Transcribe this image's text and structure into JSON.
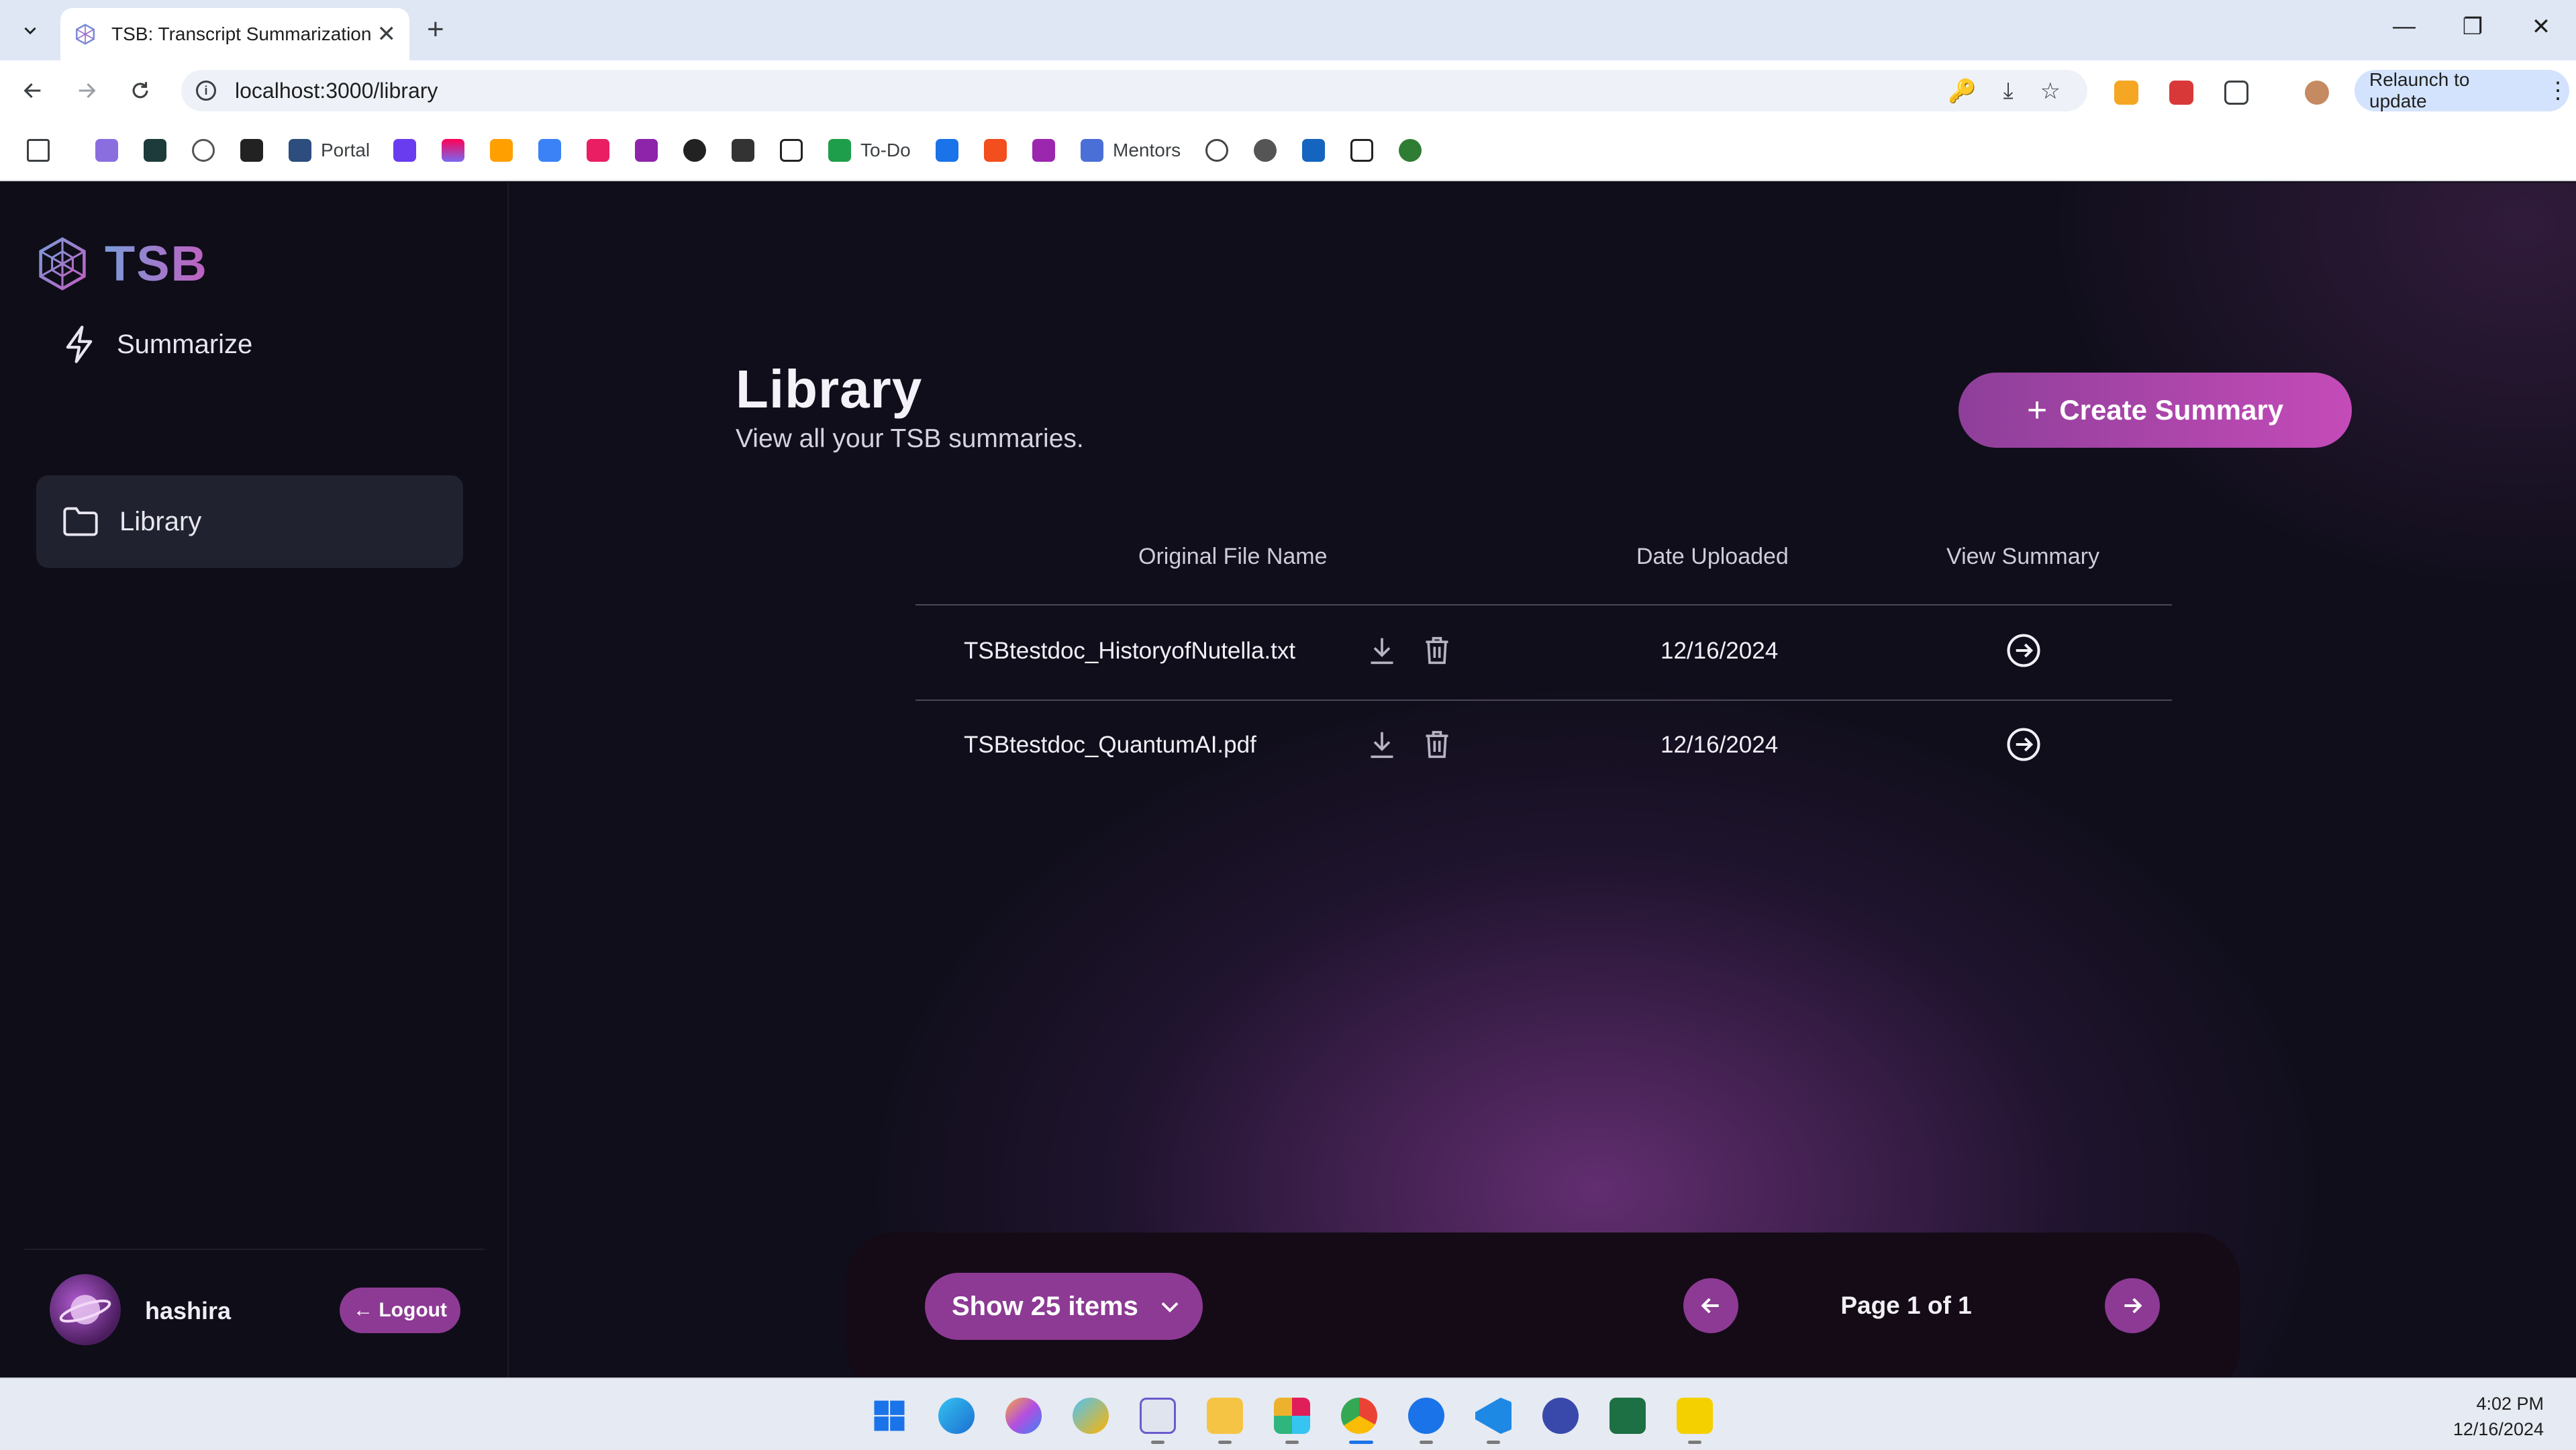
{
  "browser": {
    "tab_title": "TSB: Transcript Summarization E",
    "url": "localhost:3000/library",
    "relaunch_label": "Relaunch to update",
    "bookmarks": [
      {
        "label": "Portal"
      },
      {
        "label": "To-Do"
      },
      {
        "label": "Mentors"
      }
    ]
  },
  "app": {
    "logo_text": "TSB",
    "nav": [
      {
        "label": "Summarize",
        "icon": "lightning-icon"
      },
      {
        "label": "Library",
        "icon": "folder-icon",
        "active": true
      }
    ],
    "user": {
      "name": "hashira",
      "logout_label": "← Logout"
    },
    "accent_color": "#8d3a94"
  },
  "library": {
    "title": "Library",
    "subtitle": "View all your TSB summaries.",
    "create_label": "Create Summary",
    "columns": [
      "Original File Name",
      "Date Uploaded",
      "View Summary"
    ],
    "rows": [
      {
        "file_name": "TSBtestdoc_HistoryofNutella.txt",
        "date": "12/16/2024"
      },
      {
        "file_name": "TSBtestdoc_QuantumAI.pdf",
        "date": "12/16/2024"
      }
    ],
    "page_size_label": "Show 25 items",
    "page_indicator": "Page 1 of 1"
  },
  "taskbar": {
    "time": "4:02 PM",
    "date": "12/16/2024"
  }
}
